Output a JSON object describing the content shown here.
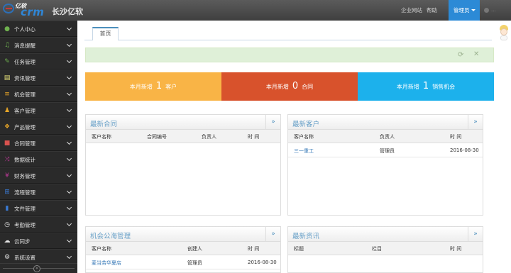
{
  "topbar": {
    "logo_small": "亿软",
    "logo_big": "crm",
    "company": "长沙亿软",
    "nav": [
      "企业网站",
      "帮助",
      "管理员"
    ],
    "user_label": "..."
  },
  "sidebar": {
    "items": [
      {
        "label": "个人中心",
        "icon": "user-icon",
        "color": "#6fb14f"
      },
      {
        "label": "消息提醒",
        "icon": "bell-icon",
        "color": "#6fb14f"
      },
      {
        "label": "任务管理",
        "icon": "edit-icon",
        "color": "#6fb14f"
      },
      {
        "label": "资讯管理",
        "icon": "document-icon",
        "color": "#e8e37a"
      },
      {
        "label": "机会管理",
        "icon": "list-icon",
        "color": "#e8a628"
      },
      {
        "label": "客户管理",
        "icon": "users-icon",
        "color": "#e8a628"
      },
      {
        "label": "产品管理",
        "icon": "box-icon",
        "color": "#e8a628"
      },
      {
        "label": "合同管理",
        "icon": "folder-icon",
        "color": "#d9534f"
      },
      {
        "label": "数据统计",
        "icon": "shuffle-icon",
        "color": "#c0399b"
      },
      {
        "label": "财务管理",
        "icon": "yen-icon",
        "color": "#c0399b"
      },
      {
        "label": "流程管理",
        "icon": "flow-icon",
        "color": "#3a7bd5"
      },
      {
        "label": "文件管理",
        "icon": "file-icon",
        "color": "#3a7bd5"
      },
      {
        "label": "考勤管理",
        "icon": "clock-icon",
        "color": "#e6e6e6"
      },
      {
        "label": "云同步",
        "icon": "cloud-icon",
        "color": "#e6e6e6"
      },
      {
        "label": "系统设置",
        "icon": "gear-icon",
        "color": "#e6e6e6"
      }
    ],
    "collapse": "«"
  },
  "tabs": {
    "home": "首页"
  },
  "stats": [
    {
      "prefix": "本月新增",
      "value": "1",
      "suffix": "客户",
      "color": "#f9b446"
    },
    {
      "prefix": "本月新增",
      "value": "0",
      "suffix": "合同",
      "color": "#d8522c"
    },
    {
      "prefix": "本月新增",
      "value": "1",
      "suffix": "销售机会",
      "color": "#1cb1ec"
    }
  ],
  "widgets": {
    "contracts": {
      "title": "最新合同",
      "more": "»",
      "cols": [
        "客户名称",
        "合同编号",
        "负责人",
        "时 间"
      ],
      "rows": []
    },
    "customers": {
      "title": "最新客户",
      "more": "»",
      "cols": [
        "客户名称",
        "负责人",
        "时 间"
      ],
      "rows": [
        {
          "name": "三一重工",
          "owner": "管理员",
          "time": "2016-08-30"
        }
      ]
    },
    "opportunity": {
      "title": "机会公海管理",
      "more": "»",
      "cols": [
        "客户名称",
        "创建人",
        "时 间"
      ],
      "rows": [
        {
          "name": "麦当劳华夏店",
          "owner": "管理员",
          "time": "2016-08-30"
        }
      ]
    },
    "news": {
      "title": "最新资讯",
      "more": "»",
      "cols": [
        "标题",
        "栏目",
        "时 间"
      ],
      "rows": []
    }
  }
}
